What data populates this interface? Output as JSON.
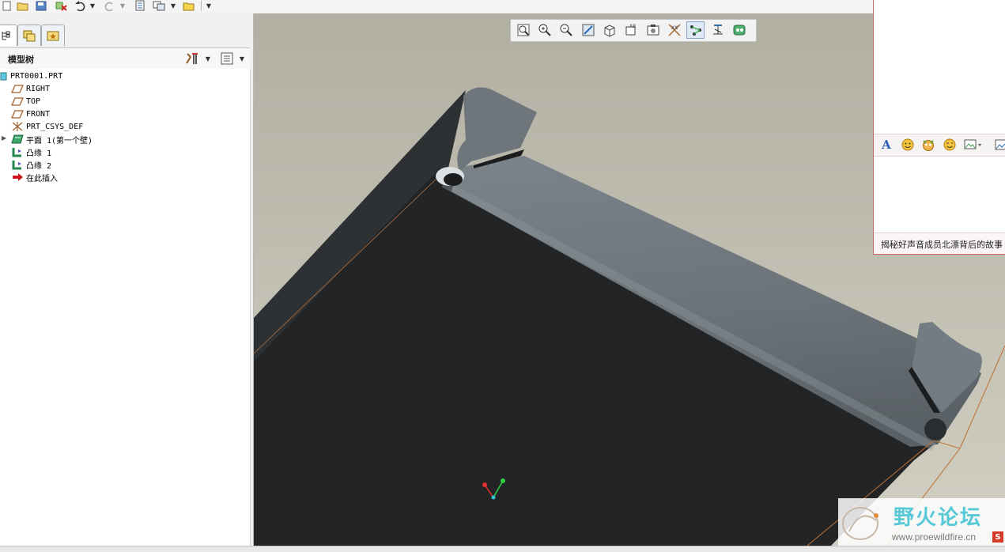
{
  "main_toolbar": {
    "icons": [
      "new-file-icon",
      "open-folder-icon",
      "save-icon",
      "erase-icon",
      "undo-icon",
      "undo-dropdown-icon",
      "redo-icon",
      "redo-dropdown-icon",
      "regenerate-icon",
      "window-icon",
      "window-dropdown-icon",
      "folder-icon",
      "more-dropdown-icon"
    ]
  },
  "navigator": {
    "tabs": [
      "model-tree-tab",
      "folder-browser-tab",
      "favorites-tab"
    ]
  },
  "model_tree": {
    "title": "模型树",
    "items": [
      {
        "label": "PRT0001.PRT",
        "icon": "part-icon"
      },
      {
        "label": "RIGHT",
        "icon": "datum-plane-icon"
      },
      {
        "label": "TOP",
        "icon": "datum-plane-icon"
      },
      {
        "label": "FRONT",
        "icon": "datum-plane-icon"
      },
      {
        "label": "PRT_CSYS_DEF",
        "icon": "csys-icon"
      },
      {
        "label": "平面 1(第一个壁)",
        "icon": "sheetmetal-wall-icon"
      },
      {
        "label": "凸缘 1",
        "icon": "flange-icon"
      },
      {
        "label": "凸缘 2",
        "icon": "flange-icon"
      },
      {
        "label": "在此插入",
        "icon": "insert-arrow-icon"
      }
    ]
  },
  "view_toolbar": {
    "buttons": [
      "refit-icon",
      "zoom-in-icon",
      "zoom-out-icon",
      "repaint-icon",
      "shading-icon",
      "saved-views-icon",
      "layers-icon",
      "datum-planes-icon",
      "datum-axes-icon",
      "datum-points-icon",
      "csys-display-icon",
      "annotation-icon"
    ],
    "active": "datum-axes-icon"
  },
  "popup": {
    "toolbar_icons": [
      "font-icon",
      "smile-emoji-icon",
      "face-emoji-icon",
      "wink-emoji-icon",
      "screenshot-icon",
      "image-icon"
    ],
    "news_text": "揭秘好声音成员北漂背后的故事"
  },
  "watermark": {
    "title": "野火论坛",
    "url": "www.proewildfire.cn"
  },
  "colors": {
    "viewport_top": "#b3b1a4",
    "viewport_bottom": "#cfccc0",
    "part_dark_face": "#222426",
    "part_flange": "#6f777d",
    "accent_blue": "#2c6db5"
  }
}
